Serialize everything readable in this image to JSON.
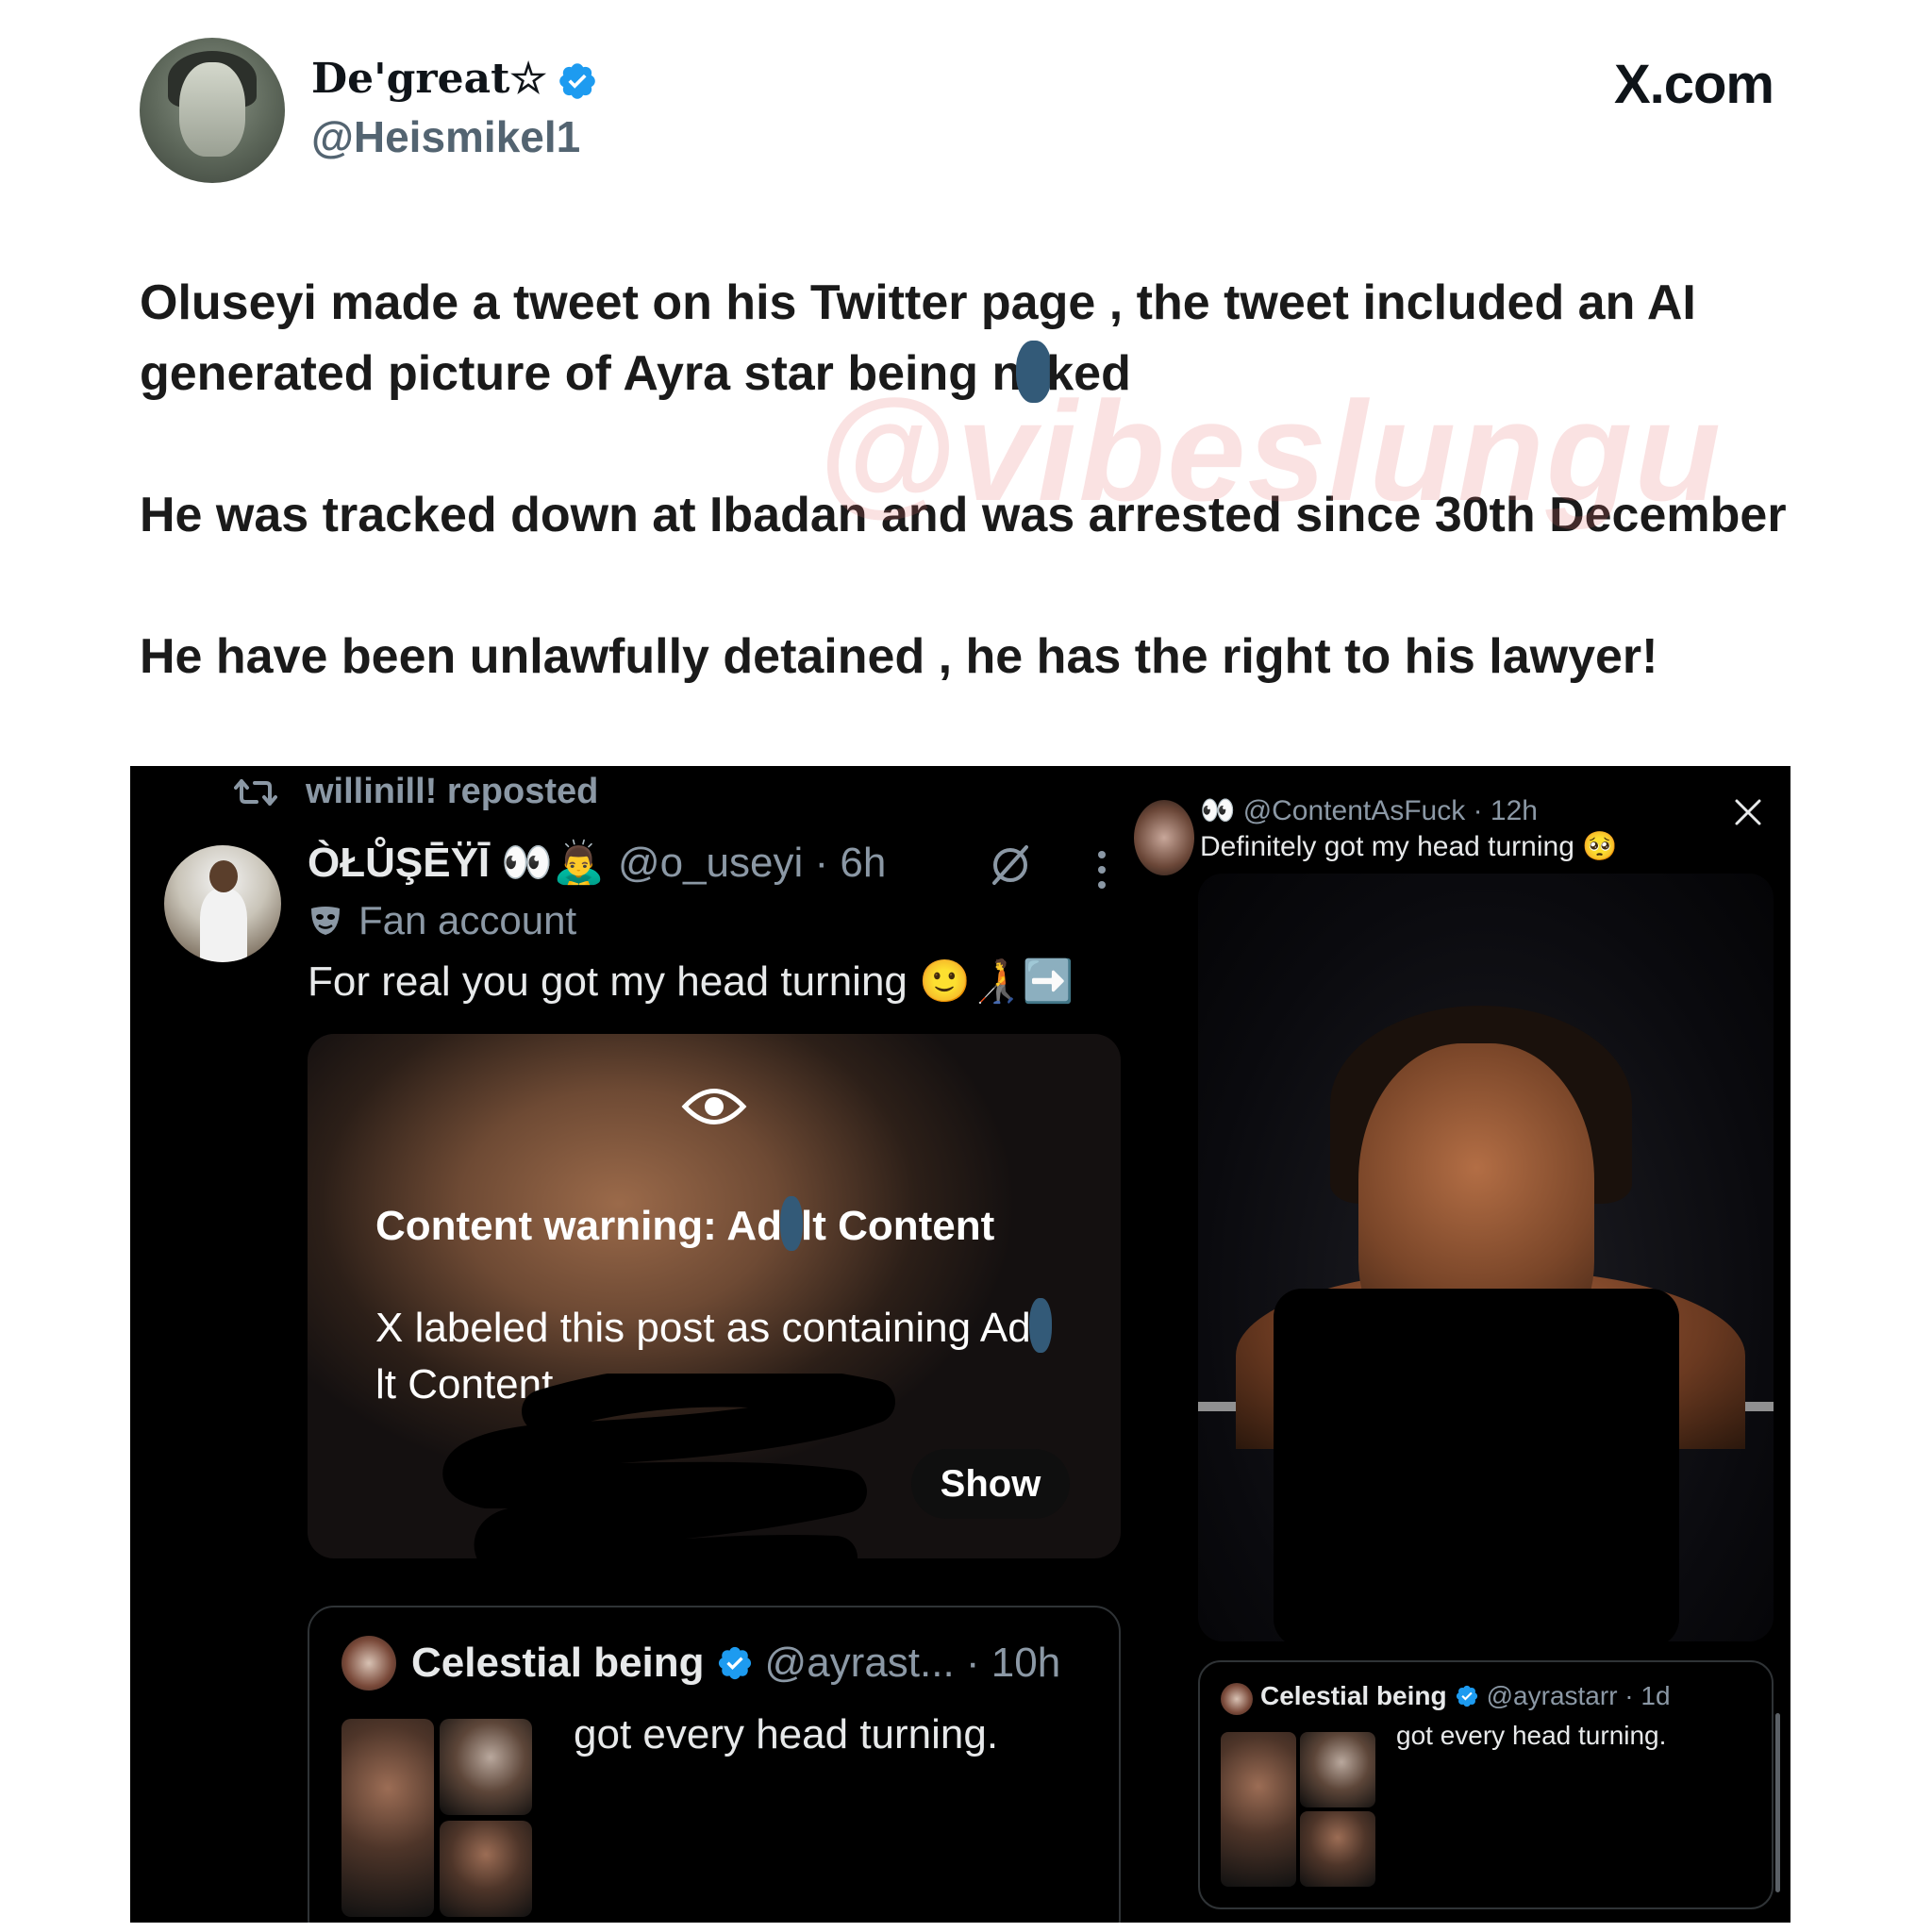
{
  "header": {
    "display_name": "De'great☆",
    "handle": "@Heismikel1",
    "brand": "X.com",
    "verified": true
  },
  "tweet": {
    "p1_before": "Oluseyi made a tweet on his Twitter page , the tweet included an AI generated picture of Ayra star being n",
    "p1_after": "ked",
    "p2": "He was tracked down at Ibadan and was arrested since 30th December",
    "p3": "He have been unlawfully detained , he has the right to his lawyer!"
  },
  "watermark": "@vibeslungu",
  "embedded_post": {
    "repost_label": "willinill! reposted",
    "author_name": "ÒŁŮŞĒŸĪ 👀🙇‍♂️",
    "author_handle_time": "@o_useyi · 6h",
    "fan_label": "Fan account",
    "text": "For real you got my head turning 🙂🧑‍🦯➡️",
    "warning_title_before": "Content warning: Ad",
    "warning_title_after": "lt Content",
    "warning_desc_before": "X labeled this post as containing Ad",
    "warning_desc_after": "lt Content.",
    "show_label": "Show",
    "quote": {
      "name": "Celestial being",
      "handle_time": "@ayrast...  · 10h",
      "text": "got every head turning."
    }
  },
  "right_post": {
    "header": "👀 @ContentAsFuck · 12h",
    "text": "Definitely got my head turning 🥺",
    "quote": {
      "name": "Celestial being",
      "handle_time": "@ayrastarr · 1d",
      "text": "got every head turning."
    }
  },
  "colors": {
    "verified_blue": "#1d9bf0",
    "dark_bg": "#000000",
    "muted_text": "#8b98a5",
    "redaction": "#335a78"
  }
}
